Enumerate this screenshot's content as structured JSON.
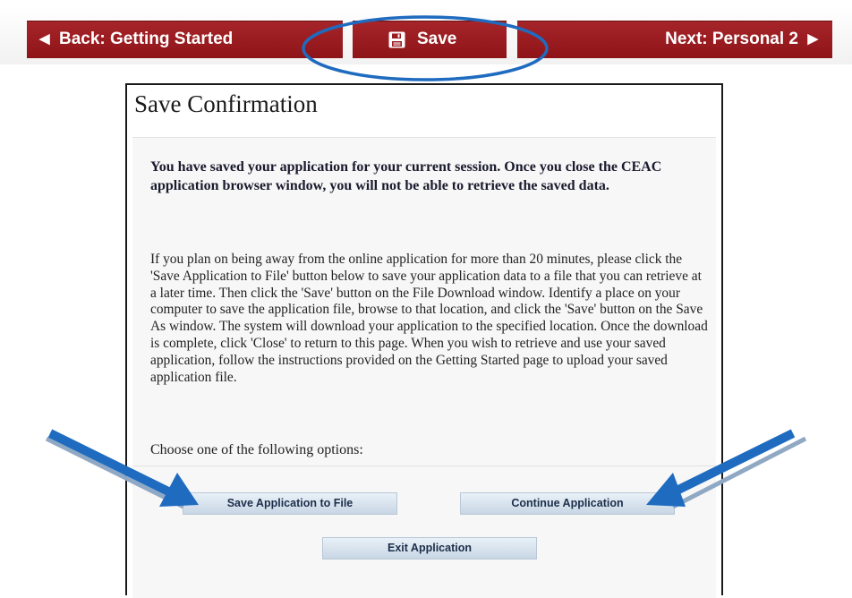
{
  "nav": {
    "back_label": "Back: Getting Started",
    "save_label": "Save",
    "next_label": "Next: Personal 2"
  },
  "dialog": {
    "title": "Save Confirmation",
    "warning": "You have saved your application for your current session. Once you close the CEAC application browser window, you will not be able to retrieve the saved data.",
    "info": "If you plan on being away from the online application for more than 20 minutes, please click the 'Save Application to File' button below to save your application data to a file that you can retrieve at a later time. Then click the 'Save' button on the File Download window. Identify a place on your computer to save the application file, browse to that location, and click the 'Save' button on the Save As window. The system will download your application to the specified location. Once the download is complete, click 'Close' to return to this page. When you wish to retrieve and use your saved application, follow the instructions provided on the Getting Started page to upload your saved application file.",
    "choose_prompt": "Choose one of the following options:",
    "buttons": {
      "save_to_file": "Save Application to File",
      "continue": "Continue Application",
      "exit": "Exit Application"
    }
  },
  "colors": {
    "nav_red": "#9a1b20",
    "annotation_blue": "#1f6bbf",
    "button_text": "#1c2e4a"
  },
  "icons": {
    "back": "left-triangle-icon",
    "save": "floppy-disk-icon",
    "next": "right-triangle-icon"
  }
}
